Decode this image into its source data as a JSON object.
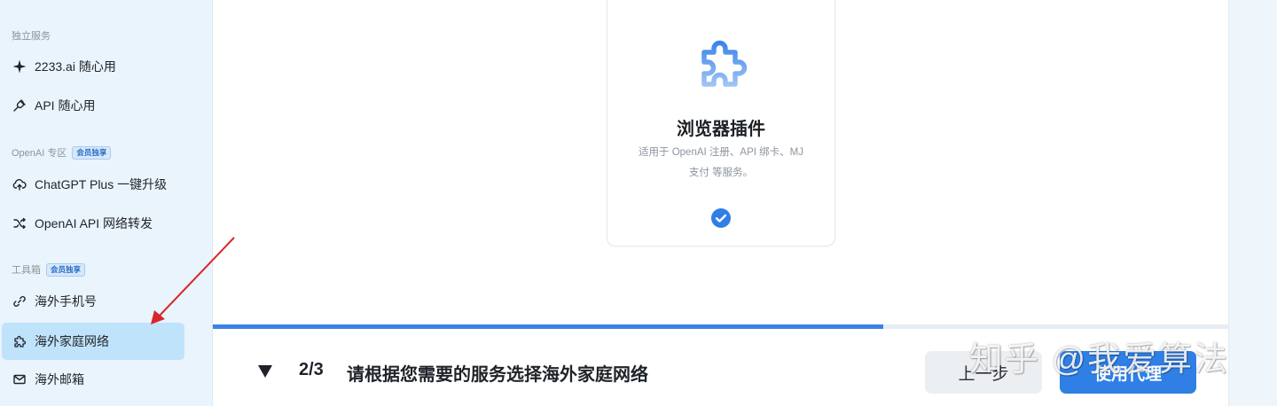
{
  "sidebar": {
    "section_independent": {
      "title": "独立服务"
    },
    "section_openai": {
      "title": "OpenAI 专区",
      "badge": "会员独享"
    },
    "section_tools": {
      "title": "工具箱",
      "badge": "会员独享"
    },
    "items": [
      {
        "label": "2233.ai 随心用",
        "icon": "sparkle-icon"
      },
      {
        "label": "API 随心用",
        "icon": "plug-icon"
      },
      {
        "label": "ChatGPT Plus 一键升级",
        "icon": "cloud-upload-icon"
      },
      {
        "label": "OpenAI API 网络转发",
        "icon": "shuffle-icon"
      },
      {
        "label": "海外手机号",
        "icon": "link-icon"
      },
      {
        "label": "海外家庭网络",
        "icon": "puzzle-icon",
        "active": true
      },
      {
        "label": "海外邮箱",
        "icon": "mail-icon"
      }
    ]
  },
  "card": {
    "icon": "puzzle-icon",
    "title": "浏览器插件",
    "desc_line1": "适用于 OpenAI 注册、API 绑卡、MJ",
    "desc_line2": "支付 等服务。",
    "selected": true
  },
  "progress": {
    "value": 0.66
  },
  "step": {
    "count": "2/3",
    "text": "请根据您需要的服务选择海外家庭网络",
    "prev_label": "上一步",
    "next_label": "使用代理"
  },
  "watermark": "知乎 @我爱算法",
  "colors": {
    "accent": "#2f7fe6",
    "sidebar_active": "#bfe3fb",
    "annotation": "#d9262b"
  }
}
